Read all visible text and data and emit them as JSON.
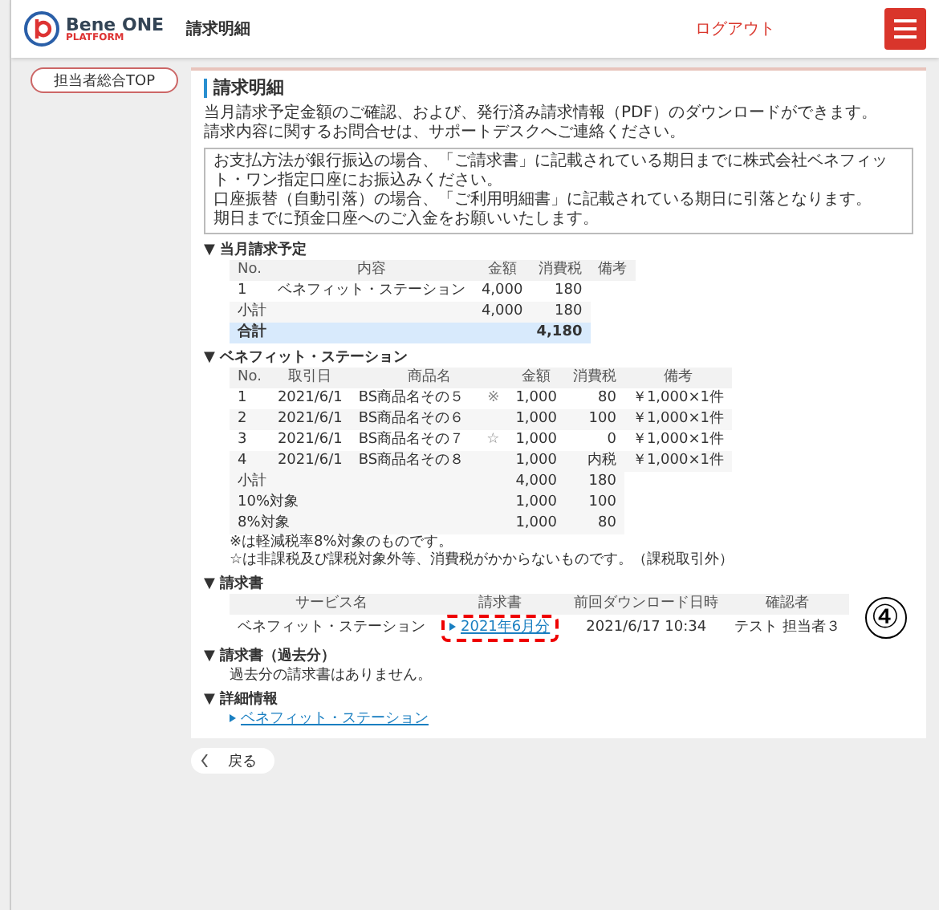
{
  "header": {
    "brand": "Bene ONE",
    "brand_sub": "PLATFORM",
    "page_title": "請求明細",
    "logout": "ログアウト"
  },
  "sidebar": {
    "button": "担当者総合TOP"
  },
  "main": {
    "title": "請求明細",
    "intro": [
      "当月請求予定金額のご確認、および、発行済み請求情報（PDF）のダウンロードができます。",
      "請求内容に関するお問合せは、サポートデスクへご連絡ください。"
    ],
    "notice": [
      "お支払方法が銀行振込の場合、「ご請求書」に記載されている期日までに株式会社ベネフィット・ワン指定口座にお振込みください。",
      "口座振替（自動引落）の場合、「ご利用明細書」に記載されている期日に引落となります。",
      "期日までに預金口座へのご入金をお願いいたします。"
    ],
    "current_month": {
      "heading": "▼ 当月請求予定",
      "columns": [
        "No.",
        "内容",
        "金額",
        "消費税",
        "備考"
      ],
      "rows": [
        {
          "no": "1",
          "content": "ベネフィット・ステーション",
          "amount": "4,000",
          "tax": "180"
        }
      ],
      "summary": [
        {
          "kind": "subtotal",
          "label": "小計",
          "amount": "4,000",
          "tax": "180"
        },
        {
          "kind": "total",
          "label": "合計",
          "amount": "4,180"
        }
      ]
    },
    "details": {
      "heading": "▼ ベネフィット・ステーション",
      "columns": [
        "No.",
        "取引日",
        "商品名",
        "金額",
        "消費税",
        "備考"
      ],
      "rows": [
        {
          "no": "1",
          "date": "2021/6/1",
          "name": "BS商品名その５",
          "mark": "※",
          "amount": "1,000",
          "tax": "80",
          "note": "￥1,000×1件"
        },
        {
          "no": "2",
          "date": "2021/6/1",
          "name": "BS商品名その６",
          "amount": "1,000",
          "tax": "100",
          "note": "￥1,000×1件"
        },
        {
          "no": "3",
          "date": "2021/6/1",
          "name": "BS商品名その７",
          "mark": "☆",
          "amount": "1,000",
          "tax": "0",
          "note": "￥1,000×1件"
        },
        {
          "no": "4",
          "date": "2021/6/1",
          "name": "BS商品名その８",
          "amount": "1,000",
          "tax": "内税",
          "note": "￥1,000×1件"
        }
      ],
      "summary": [
        {
          "kind": "subtotal",
          "label": "小計",
          "amount": "4,000",
          "tax": "180"
        },
        {
          "kind": "subtotal",
          "label": "10%対象",
          "amount": "1,000",
          "tax": "100"
        },
        {
          "kind": "subtotal",
          "label": "8%対象",
          "amount": "1,000",
          "tax": "80"
        }
      ],
      "footnotes": [
        "※は軽減税率8%対象のものです。",
        "☆は非課税及び課税対象外等、消費税がかからないものです。（課税取引外）"
      ]
    },
    "invoices": {
      "heading": "▼ 請求書",
      "columns": [
        "サービス名",
        "請求書",
        "前回ダウンロード日時",
        "確認者"
      ],
      "rows": [
        {
          "service": "ベネフィット・ステーション",
          "invoice": "2021年6月分",
          "highlighted": true,
          "downloaded": "2021/6/17 10:34",
          "confirmer": "テスト 担当者３"
        }
      ],
      "annotation": "④"
    },
    "past_invoices": {
      "heading": "▼ 請求書（過去分）",
      "message": "過去分の請求書はありません。"
    },
    "detail_info": {
      "heading": "▼ 詳細情報",
      "links": [
        "ベネフィット・ステーション"
      ]
    }
  },
  "back_button": "戻る"
}
